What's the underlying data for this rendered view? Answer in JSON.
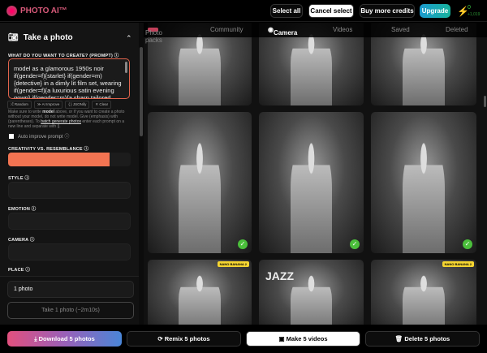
{
  "header": {
    "logo": "PHOTO AI™",
    "select_all": "Select all",
    "cancel_select": "Cancel select",
    "buy_credits": "Buy more credits",
    "upgrade": "Upgrade",
    "credits": "0",
    "credits_sub": "+1,019"
  },
  "sidebar": {
    "title": "Take a photo",
    "prompt_label": "WHAT DO YOU WANT TO CREATE? (PROMPT) ⓘ",
    "prompt_value": "model as a glamorous 1950s noir if(gender=f){starlet} if(gender=m){detective} in a dimly lit film set, wearing if(gender=f){a luxurious satin evening gown} if(gender=m){a sharp tailored suit",
    "tools": [
      "⤮ Random",
      "≫ AI Improve",
      "{ } JSONify",
      "✕ Clear"
    ],
    "help_a": "Make sure to write ",
    "help_b": "model",
    "help_c": " above, or if you want to create a photo without your model, do not write model. Give (emphasis) with (parentheses). To ",
    "help_link": "batch generate photos",
    "help_d": " enter each prompt on a new line and separate with ||.",
    "auto_improve": "Auto improve prompt ⓘ",
    "creativity_label": "CREATIVITY VS. RESEMBLANCE ⓘ",
    "creativity_value": 0.83,
    "style_label": "STYLE ⓘ",
    "emotion_label": "EMOTION ⓘ",
    "camera_label": "CAMERA ⓘ",
    "place_label": "PLACE ⓘ",
    "count": "1 photo",
    "take_button": "Take 1 photo (~2m10s)"
  },
  "tabs": {
    "photo_packs": "Photo packs",
    "community": "Community",
    "camera": "Camera",
    "videos": "Videos",
    "saved": "Saved",
    "deleted": "Deleted"
  },
  "gallery": {
    "badge": "NANO BANANA 2",
    "jazz": "JAZZ",
    "check": "✓"
  },
  "actions": {
    "download": "⤓ Download 5 photos",
    "remix": "⟳ Remix 5 photos",
    "videos": "▣ Make 5 videos",
    "delete": "🗑 Delete 5 photos"
  }
}
